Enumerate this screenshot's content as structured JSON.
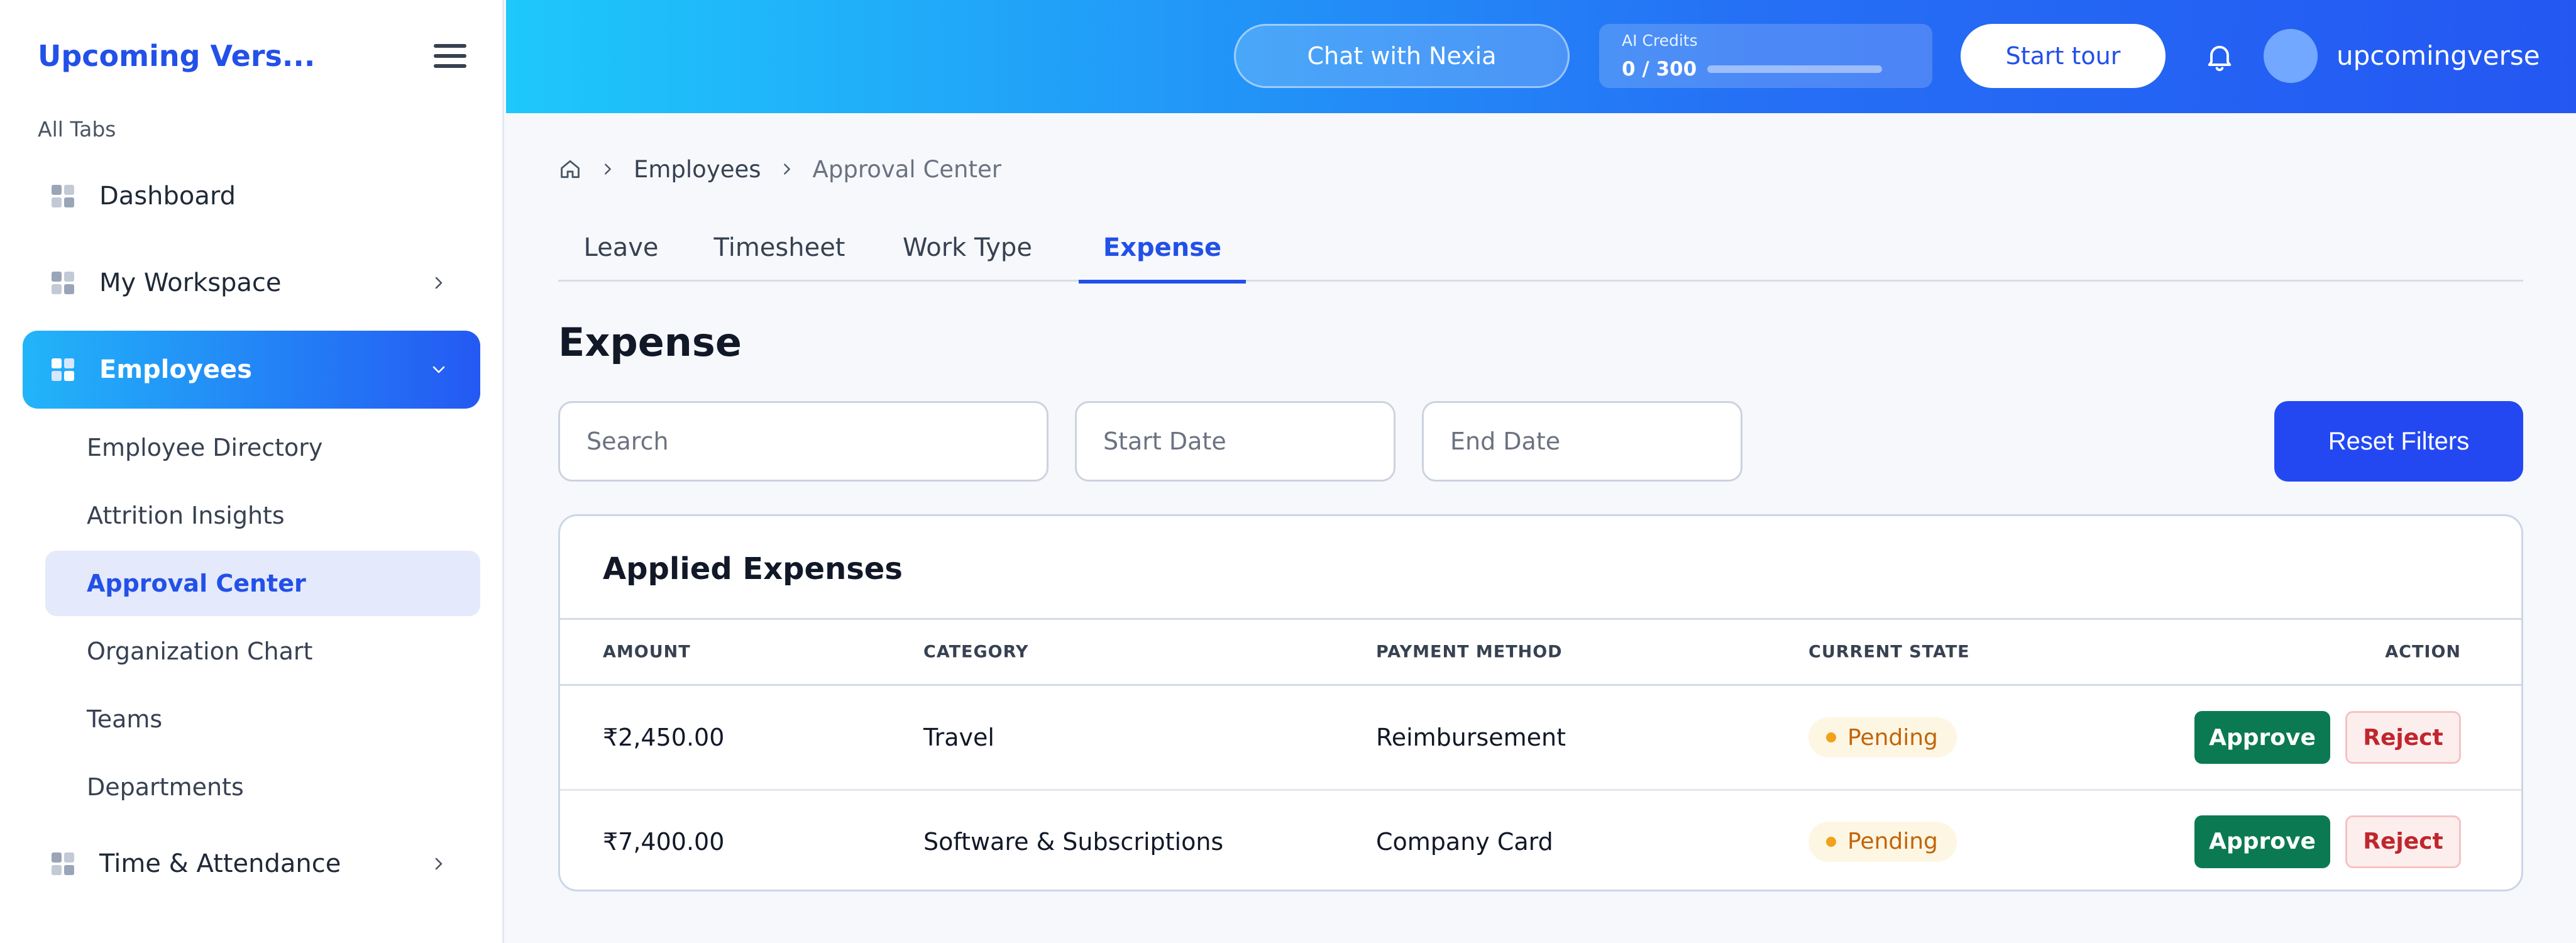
{
  "sidebar": {
    "brand": "Upcoming Vers...",
    "section_label": "All Tabs",
    "items": [
      {
        "label": "Dashboard"
      },
      {
        "label": "My Workspace"
      },
      {
        "label": "Employees"
      },
      {
        "label": "Time & Attendance"
      }
    ],
    "sub_items": [
      {
        "label": "Employee Directory"
      },
      {
        "label": "Attrition Insights"
      },
      {
        "label": "Approval Center"
      },
      {
        "label": "Organization Chart"
      },
      {
        "label": "Teams"
      },
      {
        "label": "Departments"
      }
    ]
  },
  "topbar": {
    "chat_label": "Chat with Nexia",
    "credits_label": "AI Credits",
    "credits_value": "0 / 300",
    "credits_fraction": 0,
    "tour_label": "Start tour",
    "username": "upcomingverse"
  },
  "breadcrumb": {
    "items": [
      "Employees",
      "Approval Center"
    ]
  },
  "tabs": [
    {
      "label": "Leave"
    },
    {
      "label": "Timesheet"
    },
    {
      "label": "Work Type"
    },
    {
      "label": "Expense"
    }
  ],
  "main": {
    "title": "Expense",
    "search_placeholder": "Search",
    "start_date_placeholder": "Start Date",
    "end_date_placeholder": "End Date",
    "reset_label": "Reset Filters"
  },
  "table": {
    "title": "Applied Expenses",
    "headers": {
      "amount": "AMOUNT",
      "category": "CATEGORY",
      "payment_method": "PAYMENT METHOD",
      "current_state": "CURRENT STATE",
      "action": "ACTION"
    },
    "rows": [
      {
        "amount": "₹2,450.00",
        "category": "Travel",
        "payment_method": "Reimbursement",
        "state": "Pending"
      },
      {
        "amount": "₹7,400.00",
        "category": "Software & Subscriptions",
        "payment_method": "Company Card",
        "state": "Pending"
      }
    ],
    "approve_label": "Approve",
    "reject_label": "Reject"
  },
  "colors": {
    "accent": "#2250e8",
    "approve": "#0b7a53",
    "reject": "#c0262d",
    "pending": "#c2650a"
  }
}
